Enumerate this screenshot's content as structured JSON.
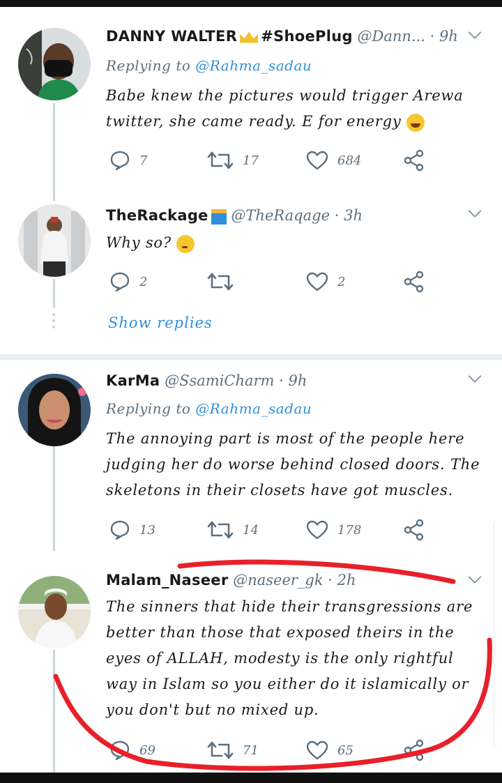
{
  "tweets": [
    {
      "name": "DANNY WALTER",
      "tag": "#ShoePlug",
      "handle": "@Dann...",
      "time": "9h",
      "replying_label": "Replying to",
      "replying_to": "@Rahma_sadau",
      "text": "Babe knew the pictures would trigger Arewa twitter, she came ready. E for energy",
      "replies": "7",
      "retweets": "17",
      "likes": "684"
    },
    {
      "name": "TheRackage",
      "handle": "@TheRaqage",
      "time": "3h",
      "text": "Why so?",
      "replies": "2",
      "retweets": "",
      "likes": "2",
      "show_replies": "Show replies"
    },
    {
      "name": "KarMa",
      "handle": "@SsamiCharm",
      "time": "9h",
      "replying_label": "Replying to",
      "replying_to": "@Rahma_sadau",
      "text": "The annoying part is most of the people here judging her do worse behind closed doors. The skeletons in their closets have got muscles.",
      "replies": "13",
      "retweets": "14",
      "likes": "178"
    },
    {
      "name": "Malam_Naseer",
      "handle": "@naseer_gk",
      "time": "2h",
      "text": "The sinners that hide their transgressions are better than those that exposed theirs in the eyes of ALLAH, modesty is the only rightful way in Islam so you either do it islamically or you don't but no mixed up.",
      "replies": "69",
      "retweets": "71",
      "likes": "65"
    }
  ],
  "separator": "·",
  "colors": {
    "muted": "#5c6f7f",
    "link": "#2f8fdc",
    "annotation": "#e8202a",
    "thread_line": "#c9d4dc"
  },
  "icons": {
    "reply": "speech-bubble-icon",
    "retweet": "retweet-icon",
    "like": "heart-icon",
    "share": "share-icon",
    "more": "chevron-down-icon"
  }
}
